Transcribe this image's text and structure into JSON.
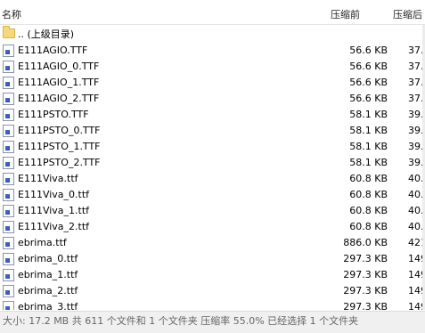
{
  "columns": {
    "name": "名称",
    "original_size": "压缩前",
    "compressed_size": "压缩后"
  },
  "parent_folder": {
    "label": ".. (上级目录)"
  },
  "files": [
    {
      "name": "E111AGIO.TTF",
      "size": "56.6 KB",
      "compressed": "37."
    },
    {
      "name": "E111AGIO_0.TTF",
      "size": "56.6 KB",
      "compressed": "37."
    },
    {
      "name": "E111AGIO_1.TTF",
      "size": "56.6 KB",
      "compressed": "37."
    },
    {
      "name": "E111AGIO_2.TTF",
      "size": "56.6 KB",
      "compressed": "37."
    },
    {
      "name": "E111PSTO.TTF",
      "size": "58.1 KB",
      "compressed": "39."
    },
    {
      "name": "E111PSTO_0.TTF",
      "size": "58.1 KB",
      "compressed": "39."
    },
    {
      "name": "E111PSTO_1.TTF",
      "size": "58.1 KB",
      "compressed": "39."
    },
    {
      "name": "E111PSTO_2.TTF",
      "size": "58.1 KB",
      "compressed": "39."
    },
    {
      "name": "E111Viva.ttf",
      "size": "60.8 KB",
      "compressed": "40."
    },
    {
      "name": "E111Viva_0.ttf",
      "size": "60.8 KB",
      "compressed": "40."
    },
    {
      "name": "E111Viva_1.ttf",
      "size": "60.8 KB",
      "compressed": "40."
    },
    {
      "name": "E111Viva_2.ttf",
      "size": "60.8 KB",
      "compressed": "40."
    },
    {
      "name": "ebrima.ttf",
      "size": "886.0 KB",
      "compressed": "421."
    },
    {
      "name": "ebrima_0.ttf",
      "size": "297.3 KB",
      "compressed": "149."
    },
    {
      "name": "ebrima_1.ttf",
      "size": "297.3 KB",
      "compressed": "149."
    },
    {
      "name": "ebrima_2.ttf",
      "size": "297.3 KB",
      "compressed": "149."
    },
    {
      "name": "ebrima_3.ttf",
      "size": "297.3 KB",
      "compressed": "149."
    }
  ],
  "status_bar": {
    "text": "大小: 17.2 MB 共 611 个文件和 1 个文件夹 压缩率 55.0% 已经选择 1 个文件夹"
  },
  "icons": {
    "folder": "folder-icon",
    "file": "font-file-icon"
  }
}
